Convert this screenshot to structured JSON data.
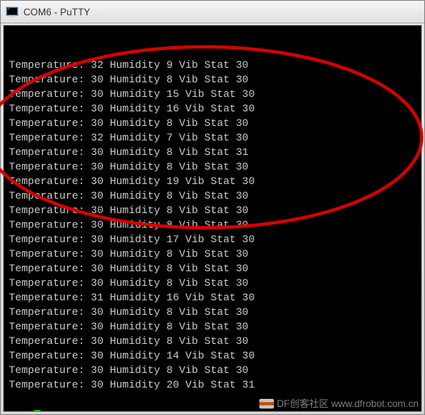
{
  "window": {
    "title": "COM6 - PuTTY"
  },
  "terminal": {
    "rows": [
      {
        "temp": 32,
        "hum": 9,
        "vib": 30
      },
      {
        "temp": 30,
        "hum": 8,
        "vib": 30
      },
      {
        "temp": 30,
        "hum": 15,
        "vib": 30
      },
      {
        "temp": 30,
        "hum": 16,
        "vib": 30
      },
      {
        "temp": 30,
        "hum": 8,
        "vib": 30
      },
      {
        "temp": 32,
        "hum": 7,
        "vib": 30
      },
      {
        "temp": 30,
        "hum": 8,
        "vib": 31
      },
      {
        "temp": 30,
        "hum": 8,
        "vib": 30
      },
      {
        "temp": 30,
        "hum": 19,
        "vib": 30
      },
      {
        "temp": 30,
        "hum": 8,
        "vib": 30
      },
      {
        "temp": 30,
        "hum": 8,
        "vib": 30
      },
      {
        "temp": 30,
        "hum": 8,
        "vib": 30
      },
      {
        "temp": 30,
        "hum": 17,
        "vib": 30
      },
      {
        "temp": 30,
        "hum": 8,
        "vib": 30
      },
      {
        "temp": 30,
        "hum": 8,
        "vib": 30
      },
      {
        "temp": 30,
        "hum": 8,
        "vib": 30
      },
      {
        "temp": 31,
        "hum": 16,
        "vib": 30
      },
      {
        "temp": 30,
        "hum": 8,
        "vib": 30
      },
      {
        "temp": 30,
        "hum": 8,
        "vib": 30
      },
      {
        "temp": 30,
        "hum": 8,
        "vib": 30
      },
      {
        "temp": 30,
        "hum": 14,
        "vib": 30
      },
      {
        "temp": 30,
        "hum": 8,
        "vib": 30
      },
      {
        "temp": 30,
        "hum": 20,
        "vib": 31
      }
    ],
    "labels": {
      "temperature": "Temperature:",
      "humidity": "Humidity",
      "vib": "Vib",
      "stat": "Stat"
    }
  },
  "annotation": {
    "type": "ellipse",
    "color": "#d80000"
  },
  "watermark": {
    "text": "DF创客社区 www.dfrobot.com.cn"
  }
}
